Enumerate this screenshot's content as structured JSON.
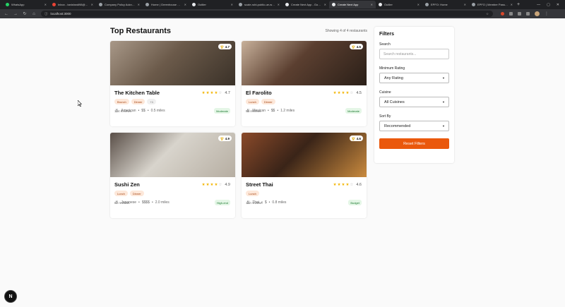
{
  "browser": {
    "tabs": [
      {
        "title": "WhatsApp",
        "color": "#25d366"
      },
      {
        "title": "Inbox - tanishwdi98@gm...",
        "color": "#ea4335"
      },
      {
        "title": "Company Policy Acknowle...",
        "color": "#9aa0a6"
      },
      {
        "title": "Home | Greenhouse Onb...",
        "color": "#9aa0a6"
      },
      {
        "title": "Outlier",
        "color": "#e8eaed"
      },
      {
        "title": "scale-rubi-public-ue-west...",
        "color": "#9aa0a6"
      },
      {
        "title": "Create Next App - Google...",
        "color": "#e8eaed"
      },
      {
        "title": "Create Next App",
        "color": "#e8eaed",
        "active": true
      },
      {
        "title": "Outlier",
        "color": "#e8eaed"
      },
      {
        "title": "EPFO: Home",
        "color": "#9aa0a6"
      },
      {
        "title": "EPFO | Member Passwor...",
        "color": "#9aa0a6"
      }
    ],
    "url": "localhost:3000"
  },
  "header": {
    "title": "Top Restaurants",
    "count": "Showing 4 of 4 restaurants"
  },
  "restaurants": [
    {
      "name": "The Kitchen Table",
      "rating": "4.7",
      "stars": 4,
      "tags": [
        "Brunch",
        "Dinner",
        "+1"
      ],
      "cuisine": "American",
      "price": "$$",
      "distance": "0.5 miles",
      "reviews": "124 reviews",
      "price_label": "Moderate",
      "image_colors": [
        "#6b5a4a",
        "#3a3128",
        "#a89888"
      ]
    },
    {
      "name": "El Farolito",
      "rating": "4.5",
      "stars": 4,
      "tags": [
        "Lunch",
        "Dinner"
      ],
      "cuisine": "Mexican",
      "price": "$$",
      "distance": "1.2 miles",
      "reviews": "98 reviews",
      "price_label": "Moderate",
      "image_colors": [
        "#5b3f30",
        "#2a1f18",
        "#c7b09a"
      ]
    },
    {
      "name": "Sushi Zen",
      "rating": "4.9",
      "stars": 4,
      "tags": [
        "Lunch",
        "Dinner"
      ],
      "cuisine": "Japanese",
      "price": "$$$$",
      "distance": "2.0 miles",
      "reviews": "87 reviews",
      "price_label": "High-end",
      "image_colors": [
        "#d8d4cc",
        "#b6aea2",
        "#5a4f48"
      ]
    },
    {
      "name": "Street Thai",
      "rating": "4.6",
      "stars": 4,
      "tags": [
        "Lunch"
      ],
      "cuisine": "Thai",
      "price": "$",
      "distance": "0.8 miles",
      "reviews": "112 reviews",
      "price_label": "Budget",
      "image_colors": [
        "#3a2418",
        "#c98a3e",
        "#8a4a2a"
      ]
    }
  ],
  "filters": {
    "title": "Filters",
    "search_label": "Search",
    "search_placeholder": "Search restaurants...",
    "rating_label": "Minimum Rating",
    "rating_value": "Any Rating",
    "cuisine_label": "Cuisine",
    "cuisine_value": "All Cuisines",
    "sort_label": "Sort By",
    "sort_value": "Recommended",
    "reset_label": "Reset Filters"
  },
  "dev_badge": "N",
  "colors": {
    "accent": "#ea580c",
    "tag_bg": "#fde8da",
    "star": "#f3b400"
  }
}
